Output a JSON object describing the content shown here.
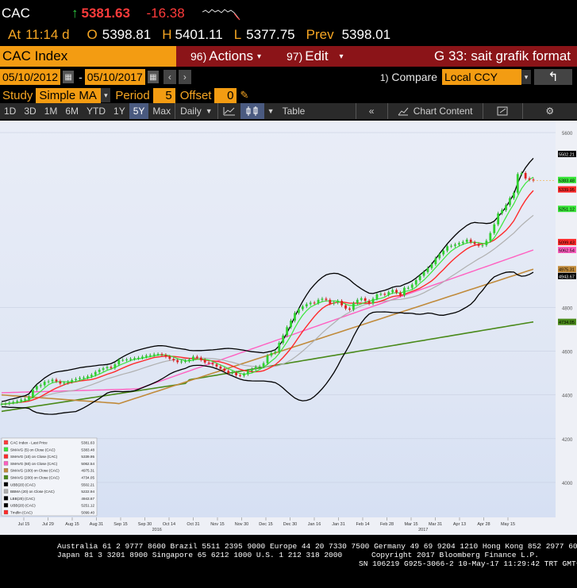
{
  "quote": {
    "ticker": "CAC",
    "direction_glyph": "↑",
    "last": "5381.63",
    "change": "-16.38"
  },
  "ohlc": {
    "at_label": "At",
    "time": "11:14 d",
    "o_label": "O",
    "open": "5398.81",
    "h_label": "H",
    "high": "5401.11",
    "l_label": "L",
    "low": "5377.75",
    "prev_label": "Prev",
    "prev": "5398.01"
  },
  "titlebar": {
    "security": "CAC Index",
    "actions_num": "96)",
    "actions_label": "Actions",
    "edit_num": "97)",
    "edit_label": "Edit",
    "chart_title": "G 33: sait grafik format"
  },
  "dates": {
    "start": "05/10/2012",
    "dash": "-",
    "end": "05/10/2017",
    "compare_num": "1)",
    "compare_label": "Compare",
    "compare_value": "Local CCY"
  },
  "study": {
    "label": "Study",
    "value": "Simple MA",
    "period_label": "Period",
    "period_value": "5",
    "offset_label": "Offset",
    "offset_value": "0"
  },
  "toolbar": {
    "ranges": [
      "1D",
      "3D",
      "1M",
      "6M",
      "YTD",
      "1Y",
      "5Y",
      "Max"
    ],
    "active_range": "5Y",
    "frequency": "Daily",
    "table_label": "Table",
    "chart_content_label": "Chart Content"
  },
  "colors": {
    "amber": "#f39c12",
    "menubar": "#8b1418",
    "price": "#ff3b3b",
    "sma5": "#39e639",
    "sma10": "#ff2a2a",
    "sma60": "#ff5fc0",
    "sma100": "#c08a3a",
    "sma200": "#4a8a1a",
    "bollinger": "#000000",
    "bbma": "#b0b0b0"
  },
  "chart_data": {
    "type": "line",
    "ylim": [
      3840,
      5640
    ],
    "yticks": [
      {
        "value": 5600,
        "label": "5600"
      },
      {
        "value": 4800,
        "label": "4800"
      },
      {
        "value": 4600,
        "label": "4600"
      },
      {
        "value": 4400,
        "label": "4400"
      },
      {
        "value": 4200,
        "label": "4200"
      },
      {
        "value": 4000,
        "label": "4000"
      }
    ],
    "xticks": [
      "Jul 15",
      "Jul 29",
      "Aug 15",
      "Aug 31",
      "Sep 15",
      "Sep 30",
      "Oct 14",
      "Oct 31",
      "Nov 15",
      "Nov 30",
      "Dec 15",
      "Dec 30",
      "Jan 16",
      "Jan 31",
      "Feb 14",
      "Feb 28",
      "Mar 15",
      "Mar 31",
      "Apr 13",
      "Apr 28",
      "May 15"
    ],
    "year_labels": [
      {
        "after": "Sep 30",
        "label": "2016"
      },
      {
        "after": "Mar 15",
        "label": "2017"
      }
    ],
    "series": [
      {
        "name": "CAC Index - Last Price",
        "legend_value": "5381.63",
        "color": "#ff3b3b",
        "values": [
          4358,
          4360,
          4365,
          4368,
          4372,
          4378,
          4380,
          4392,
          4425,
          4440,
          4445,
          4460,
          4462,
          4470,
          4462,
          4452,
          4455,
          4460,
          4468,
          4473,
          4478,
          4480,
          4485,
          4492,
          4505,
          4515,
          4522,
          4528,
          4523,
          4540,
          4560,
          4560,
          4562,
          4565,
          4568,
          4570,
          4575,
          4580,
          4582,
          4586,
          4587,
          4583,
          4575,
          4565,
          4558,
          4550,
          4553,
          4555,
          4562,
          4575,
          4570,
          4560,
          4548,
          4545,
          4540,
          4530,
          4520,
          4510,
          4500,
          4502,
          4490,
          4488,
          4495,
          4510,
          4518,
          4528,
          4530,
          4545,
          4580,
          4592,
          4598,
          4638,
          4672,
          4710,
          4740,
          4775,
          4792,
          4805,
          4815,
          4822,
          4820,
          4835,
          4840,
          4835,
          4818,
          4822,
          4830,
          4810,
          4795,
          4790,
          4820,
          4835,
          4842,
          4830,
          4818,
          4840,
          4860,
          4862,
          4858,
          4870,
          4880,
          4868,
          4855,
          4890,
          4890,
          4905,
          4925,
          4945,
          4962,
          4980,
          4998,
          5025,
          5043,
          5060,
          5080,
          5082,
          5088,
          5094,
          5100,
          5110,
          5098,
          5090,
          5082,
          5085,
          5105,
          5140,
          5180,
          5230,
          5245,
          5268,
          5300,
          5325,
          5410,
          5415,
          5390,
          5385,
          5381
        ]
      },
      {
        "name": "SMAVG (5) on Close (CAC)",
        "legend_value": "5383.48",
        "color": "#39e639"
      },
      {
        "name": "SMAVG (10) on Close (CAC)",
        "legend_value": "5339.95",
        "color": "#ff2a2a"
      },
      {
        "name": "SMAVG (60) on Close (CAC)",
        "legend_value": "5062.54",
        "color": "#ff5fc0"
      },
      {
        "name": "SMAVG (100) on Close (CAC)",
        "legend_value": "4975.31",
        "color": "#c08a3a"
      },
      {
        "name": "SMAVG (200) on Close (CAC)",
        "legend_value": "4734.05",
        "color": "#4a8a1a"
      },
      {
        "name": "UBB(20) (CAC)",
        "legend_value": "5502.21",
        "color": "#000000"
      },
      {
        "name": "BBMA (20) on Close (CAC)",
        "legend_value": "5222.94",
        "color": "#b0b0b0"
      },
      {
        "name": "LBB(20) (CAC)",
        "legend_value": "4943.67",
        "color": "#000000"
      },
      {
        "name": "UBB(20) (CAC)",
        "legend_value": "5251.12",
        "color": "#000000"
      },
      {
        "name": "Tmdlin (CAC)",
        "legend_value": "5099.40",
        "color": "#ff2a2a"
      }
    ],
    "right_labels": [
      {
        "value": 5502,
        "label": "5502.21",
        "color": "#000000",
        "text": "#fff"
      },
      {
        "value": 5383,
        "label": "5383.48",
        "color": "#39e639",
        "text": "#000"
      },
      {
        "value": 5340,
        "label": "5339.95",
        "color": "#ff2a2a",
        "text": "#000"
      },
      {
        "value": 5251,
        "label": "5251.12",
        "color": "#39e639",
        "text": "#000"
      },
      {
        "value": 5099,
        "label": "5099.43",
        "color": "#ff2a2a",
        "text": "#000"
      },
      {
        "value": 5063,
        "label": "5062.54",
        "color": "#ff5fc0",
        "text": "#000"
      },
      {
        "value": 4975,
        "label": "4975.31",
        "color": "#c08a3a",
        "text": "#000"
      },
      {
        "value": 4944,
        "label": "4943.67",
        "color": "#000000",
        "text": "#fff"
      },
      {
        "value": 4734,
        "label": "4734.05",
        "color": "#4a8a1a",
        "text": "#000"
      }
    ]
  },
  "footer": {
    "line1": "Australia 61 2 9777 8600 Brazil 5511 2395 9000 Europe 44 20 7330 7500 Germany 49 69 9204 1210 Hong Kong 852 2977 6000",
    "line2a": "Japan 81 3 3201 8900       Singapore 65 6212 1000       U.S. 1 212 318 2000",
    "line2b": "Copyright 2017 Bloomberg Finance L.P.",
    "line3": "SN 106219 G925-3066-2 10-May-17 11:29:42 TRT  GMT+3:00"
  }
}
